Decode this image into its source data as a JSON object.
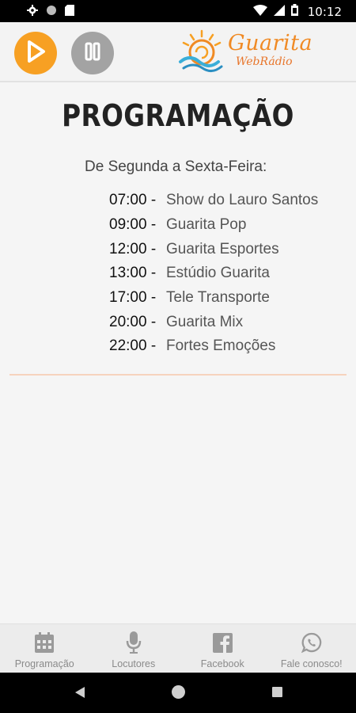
{
  "status_bar": {
    "time": "10:12",
    "icons": [
      "settings-icon",
      "circle-icon",
      "sd-card-icon",
      "wifi-icon",
      "signal-icon",
      "battery-icon"
    ]
  },
  "header": {
    "play_icon": "play-icon",
    "pause_icon": "pause-icon",
    "logo_title": "Guarita",
    "logo_subtitle": "WebRádio",
    "colors": {
      "play": "#f7a023",
      "pause": "#a3a3a3",
      "logo": "#f08a24"
    }
  },
  "main": {
    "title": "PROGRAMAÇÃO",
    "heading": "De Segunda a Sexta-Feira:",
    "schedule": [
      {
        "time": "07:00 -",
        "program": "Show do Lauro Santos"
      },
      {
        "time": "09:00 -",
        "program": "Guarita Pop"
      },
      {
        "time": "12:00 -",
        "program": "Guarita Esportes"
      },
      {
        "time": "13:00 -",
        "program": "Estúdio Guarita"
      },
      {
        "time": "17:00 -",
        "program": "Tele Transporte"
      },
      {
        "time": "20:00 -",
        "program": "Guarita Mix"
      },
      {
        "time": "22:00 -",
        "program": "Fortes Emoções"
      }
    ]
  },
  "bottom_nav": {
    "items": [
      {
        "label": "Programação",
        "icon": "calendar-icon"
      },
      {
        "label": "Locutores",
        "icon": "microphone-icon"
      },
      {
        "label": "Facebook",
        "icon": "facebook-icon"
      },
      {
        "label": "Fale conosco!",
        "icon": "whatsapp-icon"
      }
    ]
  },
  "system_nav": {
    "icons": [
      "back-icon",
      "home-icon",
      "recents-icon"
    ]
  }
}
